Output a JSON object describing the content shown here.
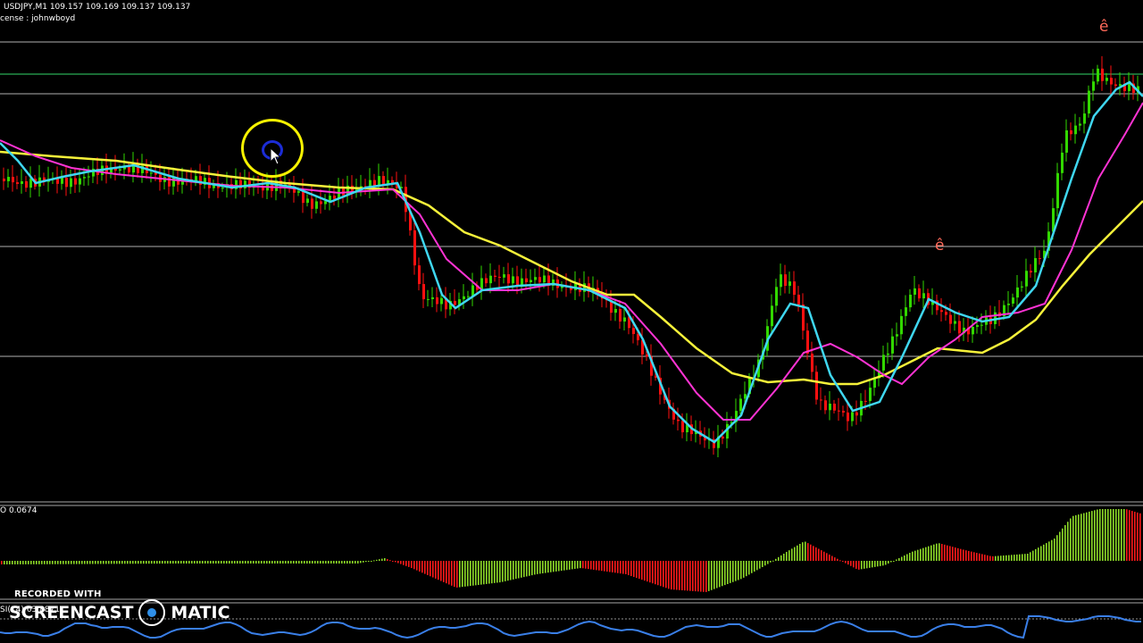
{
  "header": {
    "symbol_line": "USDJPY,M1  109.157 109.169 109.137 109.137",
    "license_line": "cense : johnwboyd"
  },
  "panes": {
    "osc_label": "O 0.0674",
    "rsi_label": "SI(14) 63.8871"
  },
  "signals": [
    {
      "glyph": "ê"
    },
    {
      "glyph": "ê"
    }
  ],
  "watermark": {
    "top": "RECORDED WITH",
    "left": "SCREENCAST",
    "right": "MATIC"
  },
  "colors": {
    "bull": "#32d800",
    "bear": "#ff1010",
    "fast_ma": "#3fd7f0",
    "mid_ma": "#ff33d4",
    "slow_ma": "#f6f23a",
    "hline": "#cfcfcf",
    "green_hline": "#35d96a",
    "osc_pos": "#8edb28",
    "osc_neg": "#ff1a1a",
    "rsi": "#3a7fe8",
    "signal": "#ff6a5a"
  },
  "chart_data": {
    "type": "candlestick",
    "symbol": "USDJPY",
    "timeframe": "M1",
    "ohlc": [
      109.157,
      109.169,
      109.137,
      109.137
    ],
    "indicators": [
      {
        "value": 0.0674
      },
      {
        "value": 63.8871
      }
    ]
  }
}
